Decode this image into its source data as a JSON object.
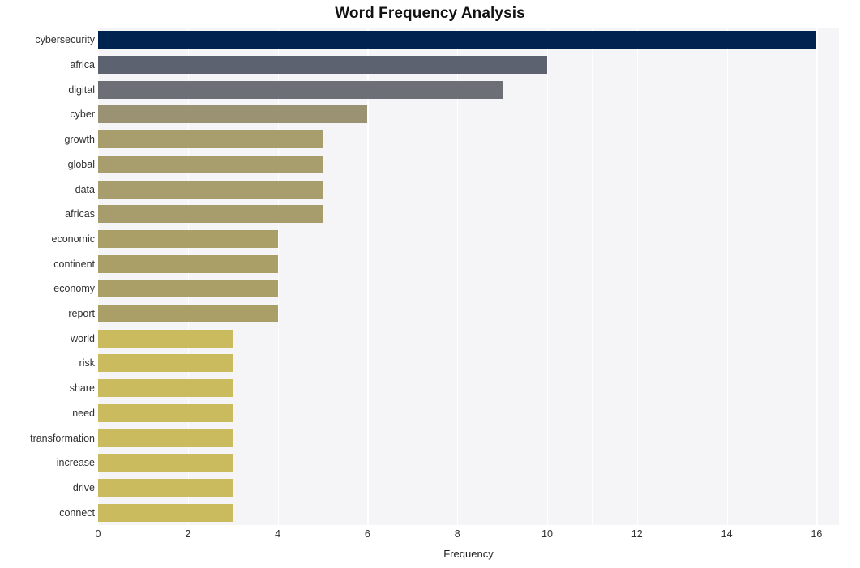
{
  "chart_data": {
    "type": "bar",
    "orientation": "horizontal",
    "title": "Word Frequency Analysis",
    "xlabel": "Frequency",
    "ylabel": "",
    "xlim": [
      0,
      16.5
    ],
    "xticks": [
      0,
      2,
      4,
      6,
      8,
      10,
      12,
      14,
      16
    ],
    "xticklabels": [
      "0",
      "2",
      "4",
      "6",
      "8",
      "10",
      "12",
      "14",
      "16"
    ],
    "grid": true,
    "legend": null,
    "categories": [
      "cybersecurity",
      "africa",
      "digital",
      "cyber",
      "growth",
      "global",
      "data",
      "africas",
      "economic",
      "continent",
      "economy",
      "report",
      "world",
      "risk",
      "share",
      "need",
      "transformation",
      "increase",
      "drive",
      "connect"
    ],
    "values": [
      16,
      10,
      9,
      6,
      5,
      5,
      5,
      5,
      4,
      4,
      4,
      4,
      3,
      3,
      3,
      3,
      3,
      3,
      3,
      3
    ],
    "bar_colors": [
      "#00234f",
      "#5d6271",
      "#6c6f76",
      "#9b9273",
      "#a89d6d",
      "#a89d6d",
      "#a89d6d",
      "#a79c6c",
      "#ab9f68",
      "#ab9f68",
      "#ab9f68",
      "#ab9f68",
      "#cbbb5f",
      "#cbbb5f",
      "#cbbb5f",
      "#cbbb5f",
      "#cbbb5f",
      "#cbbb5f",
      "#cbbb5f",
      "#cbbb5f"
    ],
    "plot_background": "#f5f5f7",
    "grid_color": "#ffffff",
    "figure_background": "#ffffff"
  }
}
